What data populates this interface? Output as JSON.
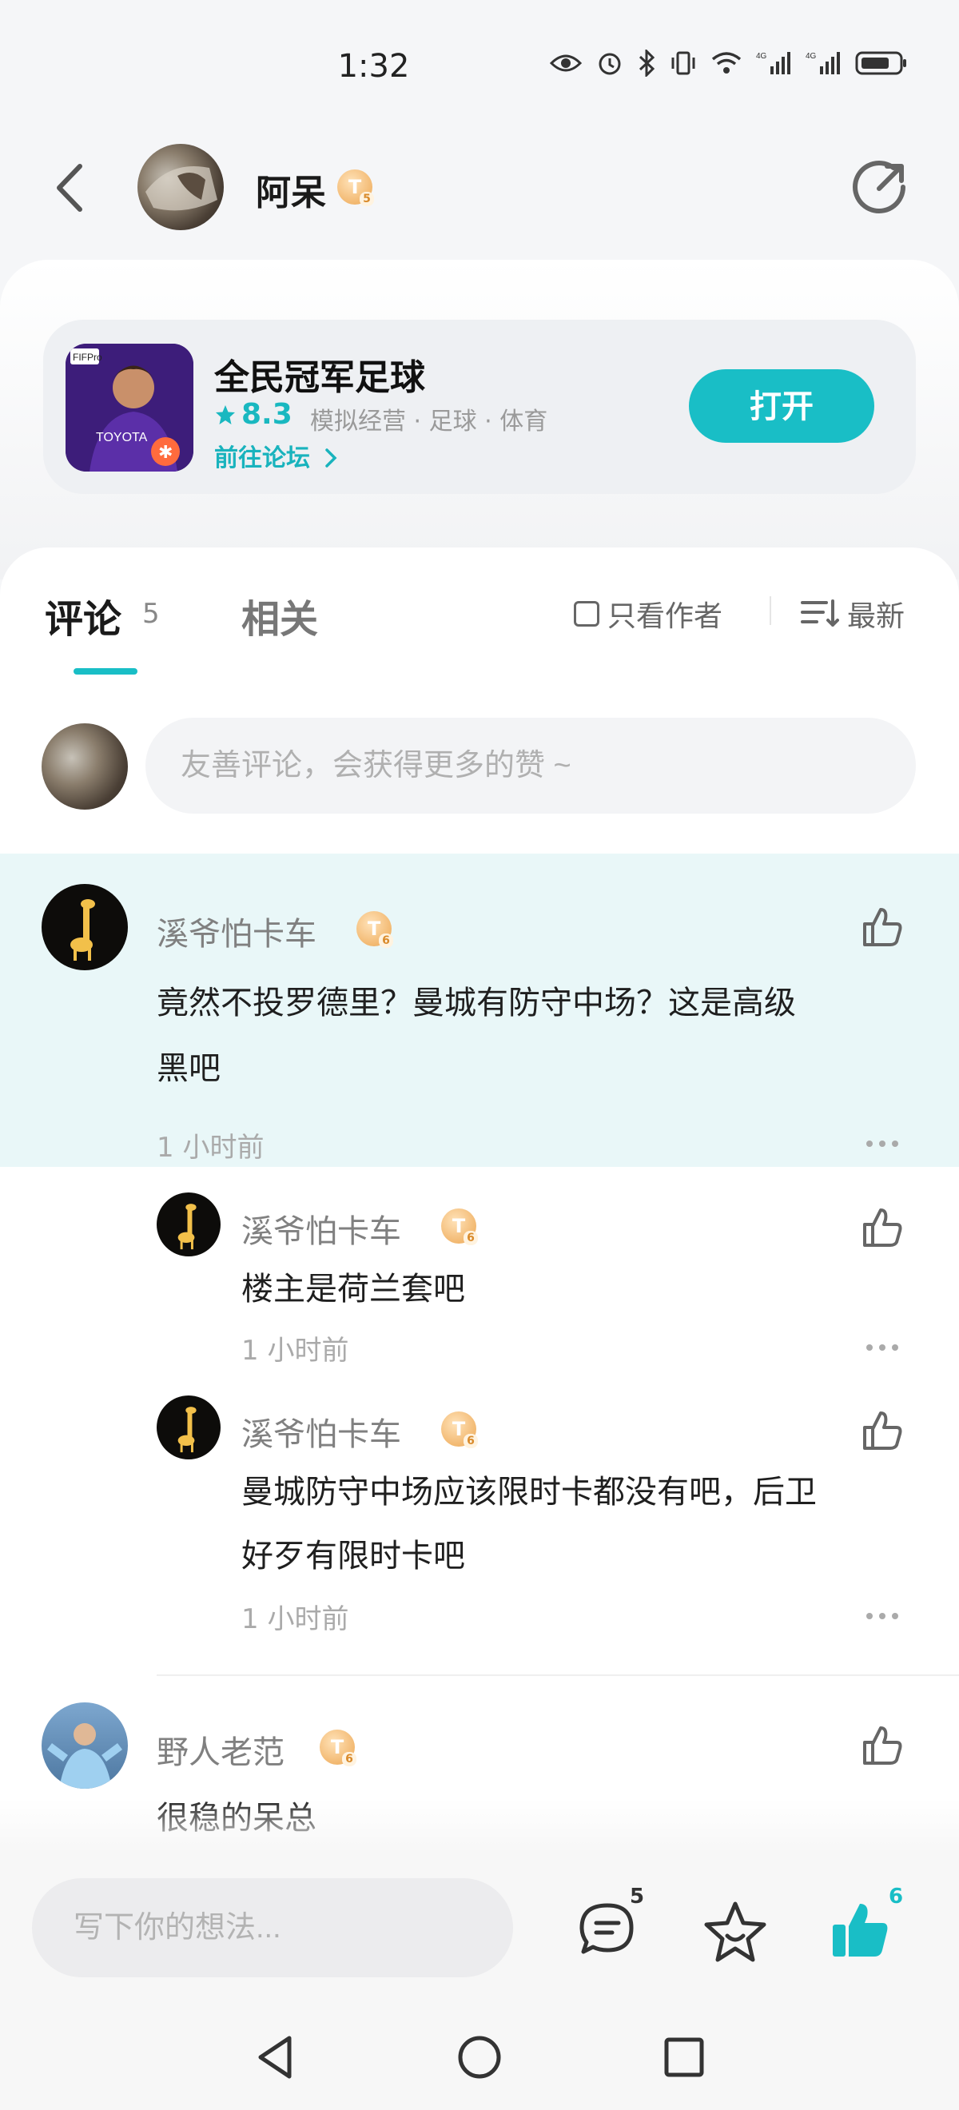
{
  "status_bar": {
    "time": "1:32"
  },
  "header": {
    "name": "阿呆",
    "badge_letter": "T",
    "badge_level": "5"
  },
  "app": {
    "name": "全民冠军足球",
    "rating": "8.3",
    "tags": "模拟经营 · 足球 · 体育",
    "forum_link": "前往论坛",
    "open_label": "打开"
  },
  "tabs": {
    "comments_label": "评论",
    "comments_count": "5",
    "related_label": "相关",
    "only_author": "只看作者",
    "sort_label": "最新"
  },
  "comment_input": {
    "placeholder": "友善评论，会获得更多的赞 ~"
  },
  "comments": [
    {
      "user": "溪爷怕卡车",
      "badge_level": "6",
      "text_line1": "竟然不投罗德里？曼城有防守中场？这是高级",
      "text_line2": "黑吧",
      "time": "1 小时前",
      "replies": [
        {
          "user": "溪爷怕卡车",
          "badge_level": "6",
          "text_line1": "楼主是荷兰套吧",
          "time": "1 小时前"
        },
        {
          "user": "溪爷怕卡车",
          "badge_level": "6",
          "text_line1": "曼城防守中场应该限时卡都没有吧，后卫",
          "text_line2": "好歹有限时卡吧",
          "time": "1 小时前"
        }
      ]
    },
    {
      "user": "野人老范",
      "badge_level": "6",
      "text_line1": "很稳的呆总"
    }
  ],
  "bottom": {
    "placeholder": "写下你的想法...",
    "comment_count": "5",
    "like_count": "6",
    "accent": "#19bec6"
  }
}
